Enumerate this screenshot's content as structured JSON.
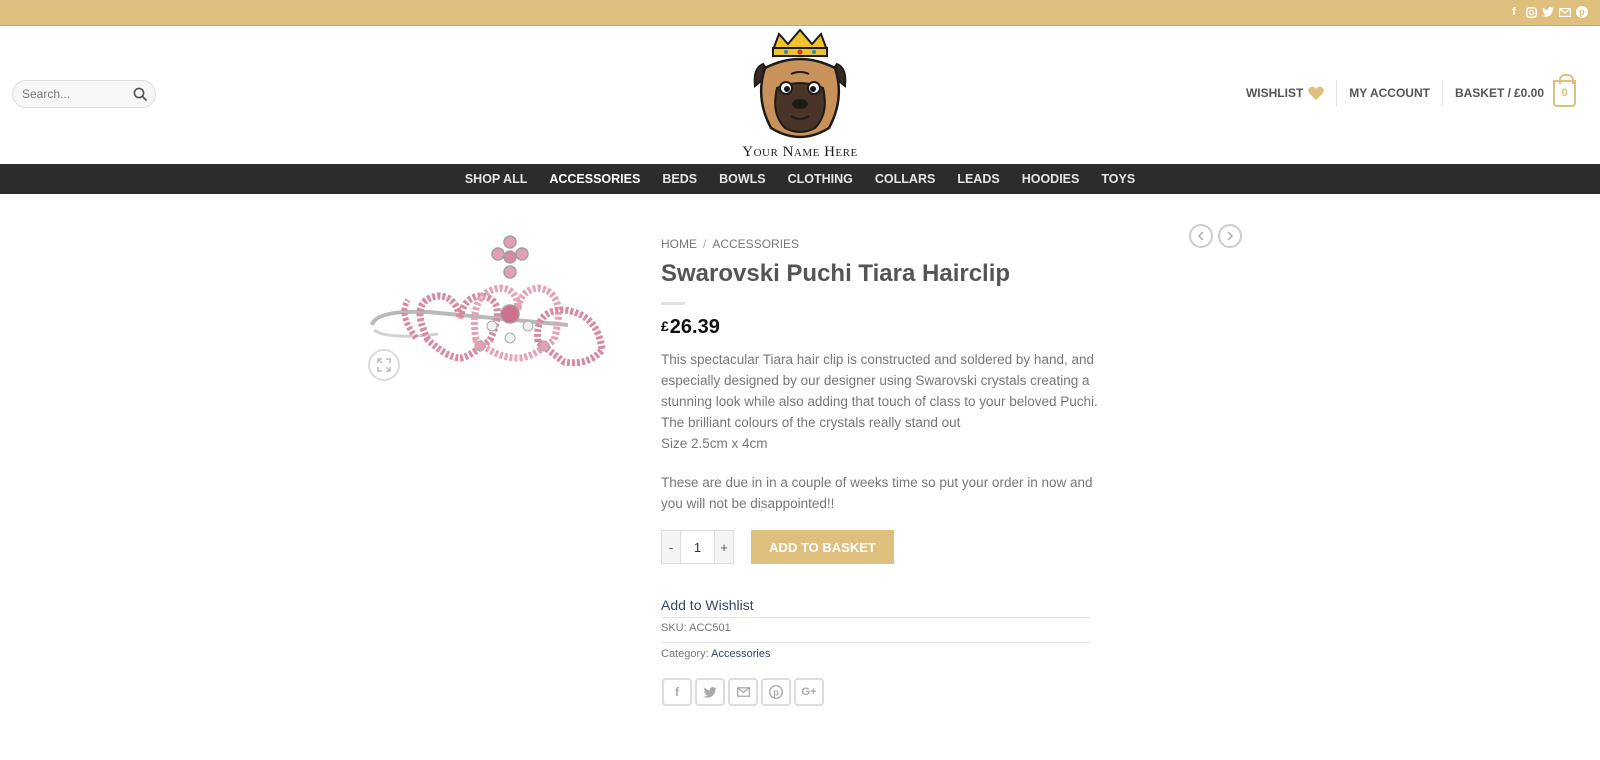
{
  "search": {
    "placeholder": "Search..."
  },
  "header": {
    "logo_text": "Your Name Here",
    "wishlist_label": "WISHLIST",
    "account_label": "MY ACCOUNT",
    "basket_label": "BASKET /",
    "basket_total": "£0.00",
    "basket_count": "0"
  },
  "nav": {
    "items": [
      {
        "label": "SHOP ALL"
      },
      {
        "label": "ACCESSORIES"
      },
      {
        "label": "BEDS"
      },
      {
        "label": "BOWLS"
      },
      {
        "label": "CLOTHING"
      },
      {
        "label": "COLLARS"
      },
      {
        "label": "LEADS"
      },
      {
        "label": "HOODIES"
      },
      {
        "label": "TOYS"
      }
    ]
  },
  "breadcrumb": {
    "home": "HOME",
    "sep": "/",
    "category": "ACCESSORIES"
  },
  "product": {
    "title": "Swarovski Puchi Tiara Hairclip",
    "currency": "£",
    "price": "26.39",
    "desc_1": "This spectacular Tiara hair clip is constructed and soldered by hand, and especially designed by our designer using Swarovski crystals creating a stunning look while also adding that touch of class to your beloved Puchi. The brilliant colours of the crystals really stand out",
    "desc_size": "Size 2.5cm x 4cm",
    "desc_2": "These are due in in a couple of weeks time so put your order in now and you will not be disappointed!!",
    "qty_minus": "-",
    "qty_value": "1",
    "qty_plus": "+",
    "add_to_basket": "ADD TO BASKET",
    "add_to_wishlist": "Add to Wishlist",
    "sku_label": "SKU:",
    "sku_value": "ACC501",
    "category_label": "Category:",
    "category_value": "Accessories"
  },
  "colors": {
    "accent": "#dfbf7d",
    "nav_bg": "#2c2c2c",
    "link": "#334862"
  },
  "icons": {
    "top_social": [
      "facebook-icon",
      "instagram-icon",
      "twitter-icon",
      "email-icon",
      "pinterest-icon"
    ],
    "share": [
      "facebook-icon",
      "twitter-icon",
      "email-icon",
      "pinterest-icon",
      "google-plus-icon"
    ]
  }
}
